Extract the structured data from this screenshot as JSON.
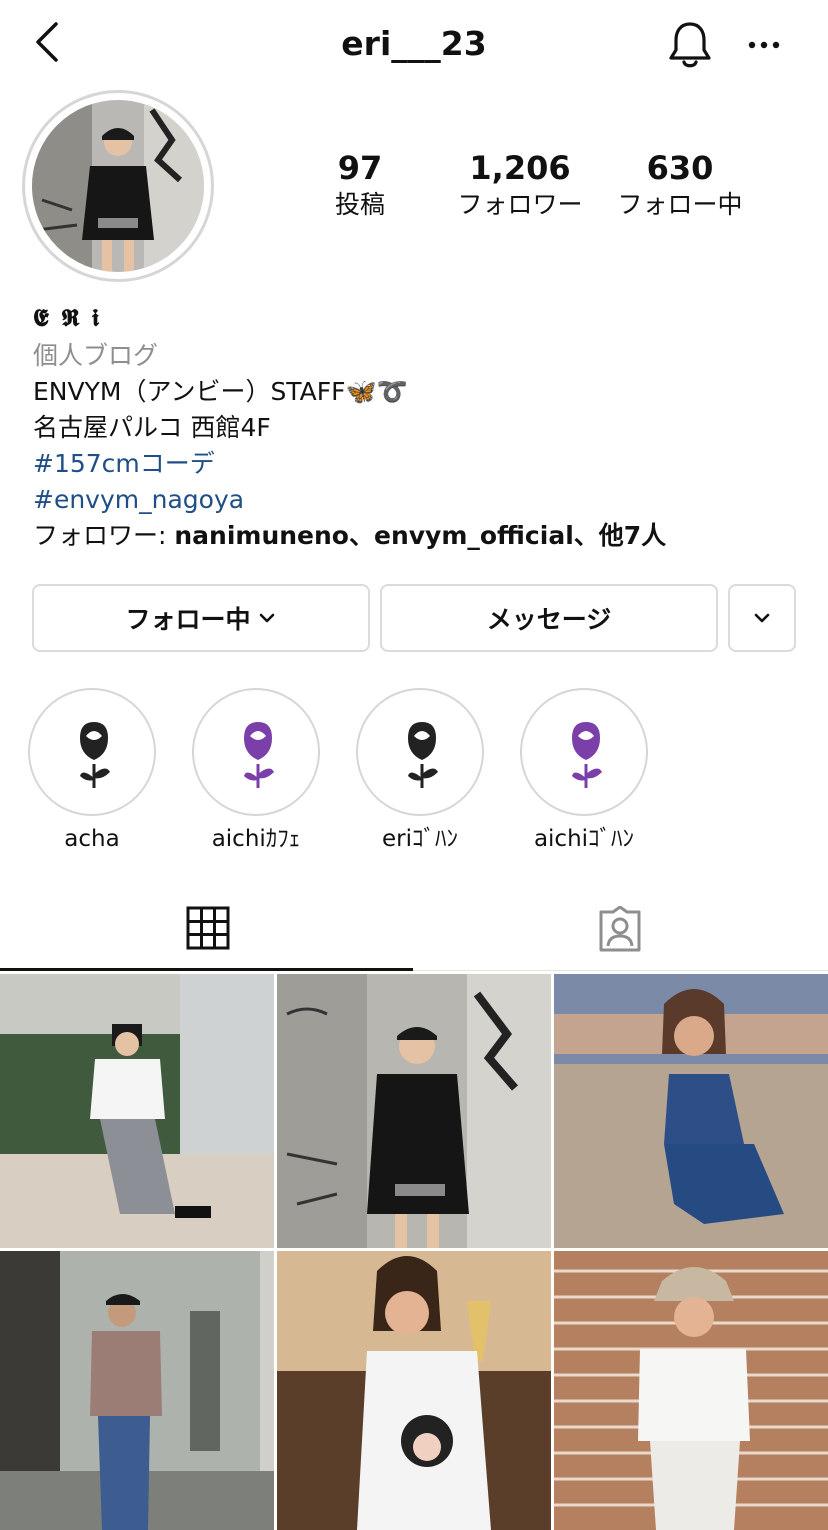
{
  "header": {
    "username": "eri___23"
  },
  "profile": {
    "stats": [
      {
        "value": "97",
        "label": "投稿"
      },
      {
        "value": "1,206",
        "label": "フォロワー"
      },
      {
        "value": "630",
        "label": "フォロー中"
      }
    ],
    "display_name": "𝕰 𝕽 𝖎",
    "category": "個人ブログ",
    "bio_line1": "ENVYM（アンビー）STAFF🦋➰",
    "bio_line2": "名古屋パルコ  西館4F",
    "hashtags": [
      "#157cmコーデ",
      "#envym_nagoya"
    ],
    "followed_by_prefix": "フォロワー: ",
    "followed_by_names": "nanimuneno、envym_official、他7人"
  },
  "actions": {
    "following_label": "フォロー中",
    "message_label": "メッセージ"
  },
  "highlights": [
    {
      "label": "acha",
      "flower_color": "#222222"
    },
    {
      "label": "aichiｶﾌｪ",
      "flower_color": "#7a3fa8"
    },
    {
      "label": "eriｺﾞﾊﾝ",
      "flower_color": "#222222"
    },
    {
      "label": "aichiｺﾞﾊﾝ",
      "flower_color": "#7a3fa8"
    }
  ],
  "icons": {
    "back": "chevron-left-icon",
    "notifications": "bell-icon",
    "more": "more-horizontal-icon",
    "grid_tab": "grid-icon",
    "tagged_tab": "tagged-person-icon",
    "dropdown": "chevron-down-icon"
  }
}
